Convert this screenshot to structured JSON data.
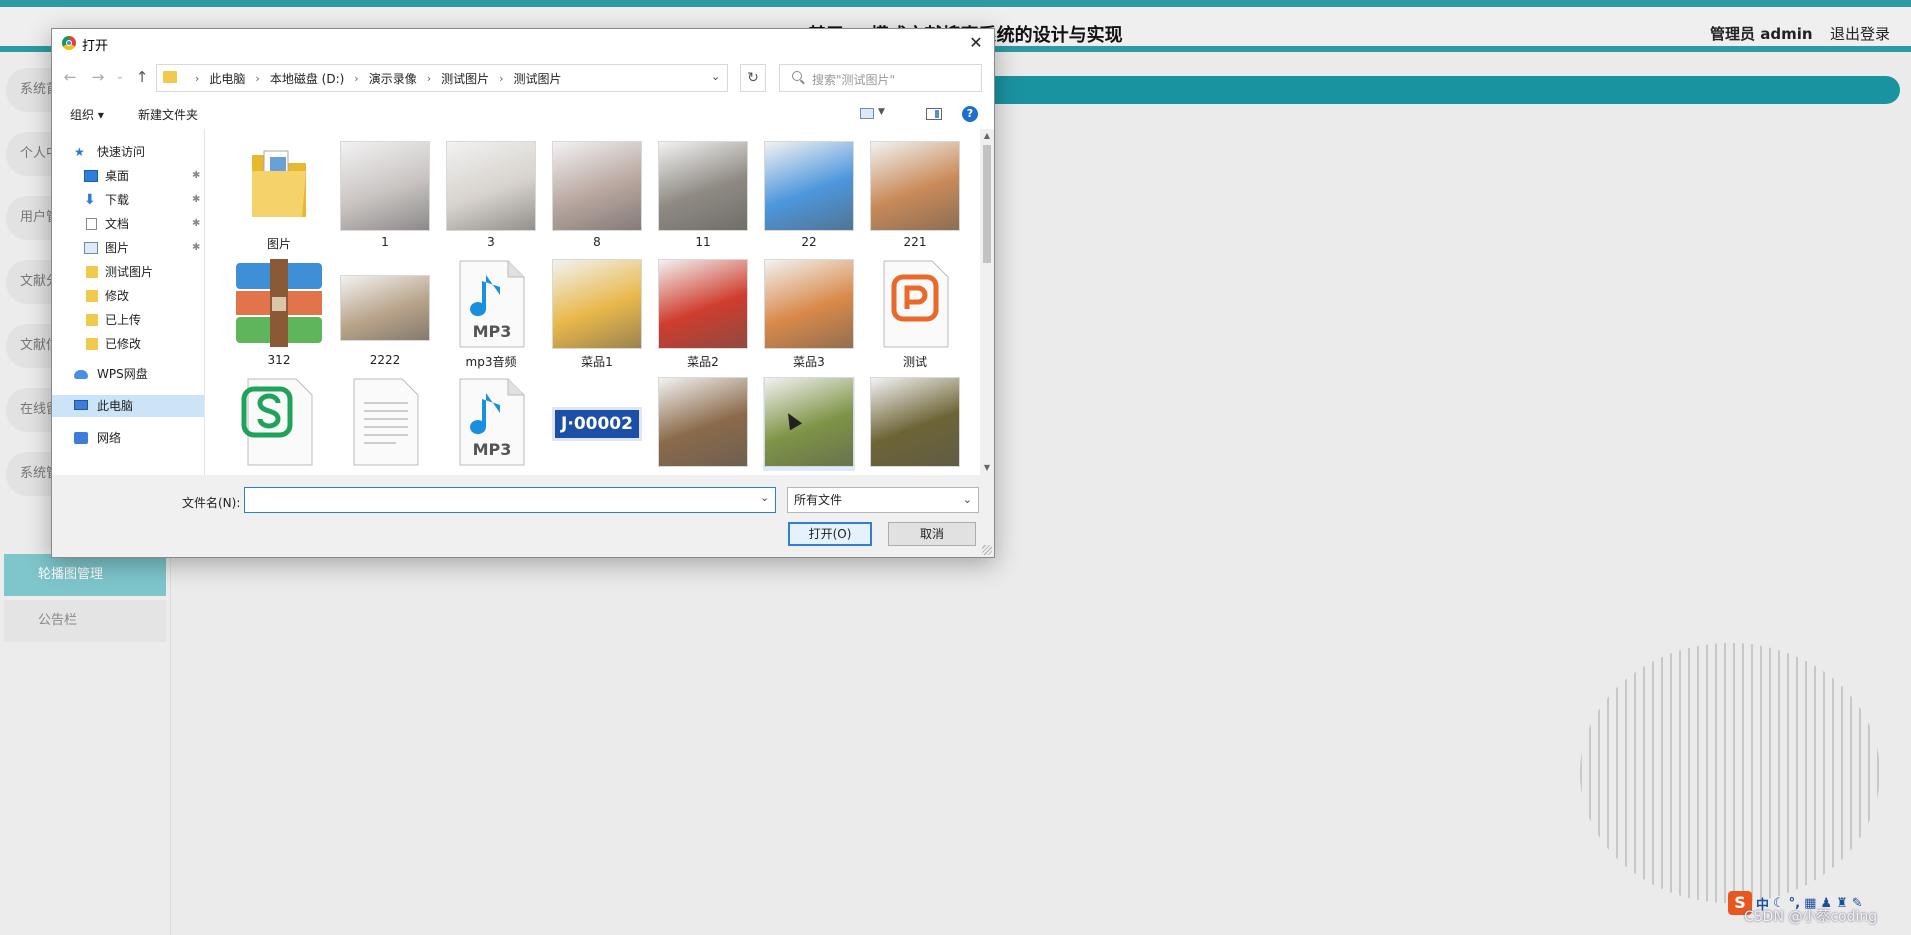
{
  "page": {
    "title": "基于BS模式文献搜索系统的设计与实现",
    "admin": "管理员 admin",
    "logout": "退出登录",
    "sidebar": [
      {
        "label": "系统首页"
      },
      {
        "label": "个人中心"
      },
      {
        "label": "用户管理"
      },
      {
        "label": "文献分类管理"
      },
      {
        "label": "文献信息管理"
      },
      {
        "label": "在线留言管理"
      },
      {
        "label": "系统管理"
      }
    ],
    "sidebar_active": "轮播图管理",
    "sidebar_notice": "公告栏",
    "watermark": "CSDN @小蔡coding",
    "ime": {
      "logo": "S",
      "lang": "中"
    }
  },
  "dialog": {
    "title": "打开",
    "close": "✕",
    "nav": {
      "back": "←",
      "forward": "→",
      "dropdown": "⌄",
      "up": "↑"
    },
    "breadcrumb": [
      "此电脑",
      "本地磁盘 (D:)",
      "演示录像",
      "测试图片",
      "测试图片"
    ],
    "refresh": "↻",
    "search_placeholder": "搜索\"测试图片\"",
    "toolbar": {
      "organize": "组织 ▾",
      "new_folder": "新建文件夹",
      "help": "?"
    },
    "nav_pane": [
      {
        "label": "快速访问",
        "icon": "star-icon"
      },
      {
        "label": "桌面",
        "icon": "desktop-icon",
        "pinned": true
      },
      {
        "label": "下载",
        "icon": "download-icon",
        "pinned": true
      },
      {
        "label": "文档",
        "icon": "document-icon",
        "pinned": true
      },
      {
        "label": "图片",
        "icon": "pictures-icon",
        "pinned": true
      },
      {
        "label": "测试图片",
        "icon": "folder-icon"
      },
      {
        "label": "修改",
        "icon": "folder-icon"
      },
      {
        "label": "已上传",
        "icon": "folder-icon"
      },
      {
        "label": "已修改",
        "icon": "folder-icon"
      },
      {
        "label": "WPS网盘",
        "icon": "cloud-icon"
      },
      {
        "label": "此电脑",
        "icon": "computer-icon",
        "selected": true
      },
      {
        "label": "网络",
        "icon": "network-icon"
      }
    ],
    "files": [
      {
        "label": "图片",
        "kind": "folder"
      },
      {
        "label": "1",
        "kind": "photo",
        "color": "#c9c4c2"
      },
      {
        "label": "3",
        "kind": "photo",
        "color": "#d7d2cc"
      },
      {
        "label": "8",
        "kind": "photo",
        "color": "#b9a7a0"
      },
      {
        "label": "11",
        "kind": "photo",
        "color": "#8f8a83"
      },
      {
        "label": "22",
        "kind": "photo",
        "color": "#4d97dc"
      },
      {
        "label": "221",
        "kind": "photo",
        "color": "#c98a58"
      },
      {
        "label": "312",
        "kind": "archive"
      },
      {
        "label": "2222",
        "kind": "photo",
        "color": "#b9a48a"
      },
      {
        "label": "mp3音频",
        "kind": "mp3"
      },
      {
        "label": "菜品1",
        "kind": "photo",
        "color": "#e9b84a"
      },
      {
        "label": "菜品2",
        "kind": "photo",
        "color": "#cf3d2d"
      },
      {
        "label": "菜品3",
        "kind": "photo",
        "color": "#d98a4a"
      },
      {
        "label": "测试",
        "kind": "ppt"
      },
      {
        "label": "",
        "kind": "sheet"
      },
      {
        "label": "",
        "kind": "doc"
      },
      {
        "label": "",
        "kind": "mp3"
      },
      {
        "label": "",
        "kind": "plate",
        "text": "J·00002"
      },
      {
        "label": "",
        "kind": "photo",
        "color": "#8b6a4a"
      },
      {
        "label": "",
        "kind": "photo",
        "color": "#7e9446",
        "selected": true
      },
      {
        "label": "",
        "kind": "photo",
        "color": "#6d6436"
      }
    ],
    "filename_label": "文件名(N):",
    "filename_value": "",
    "filetype": "所有文件",
    "open_button": "打开(O)",
    "cancel_button": "取消"
  },
  "colors": {
    "teal": "#1a93a0",
    "accent": "#2f7fd6",
    "folder": "#f2c94c"
  }
}
